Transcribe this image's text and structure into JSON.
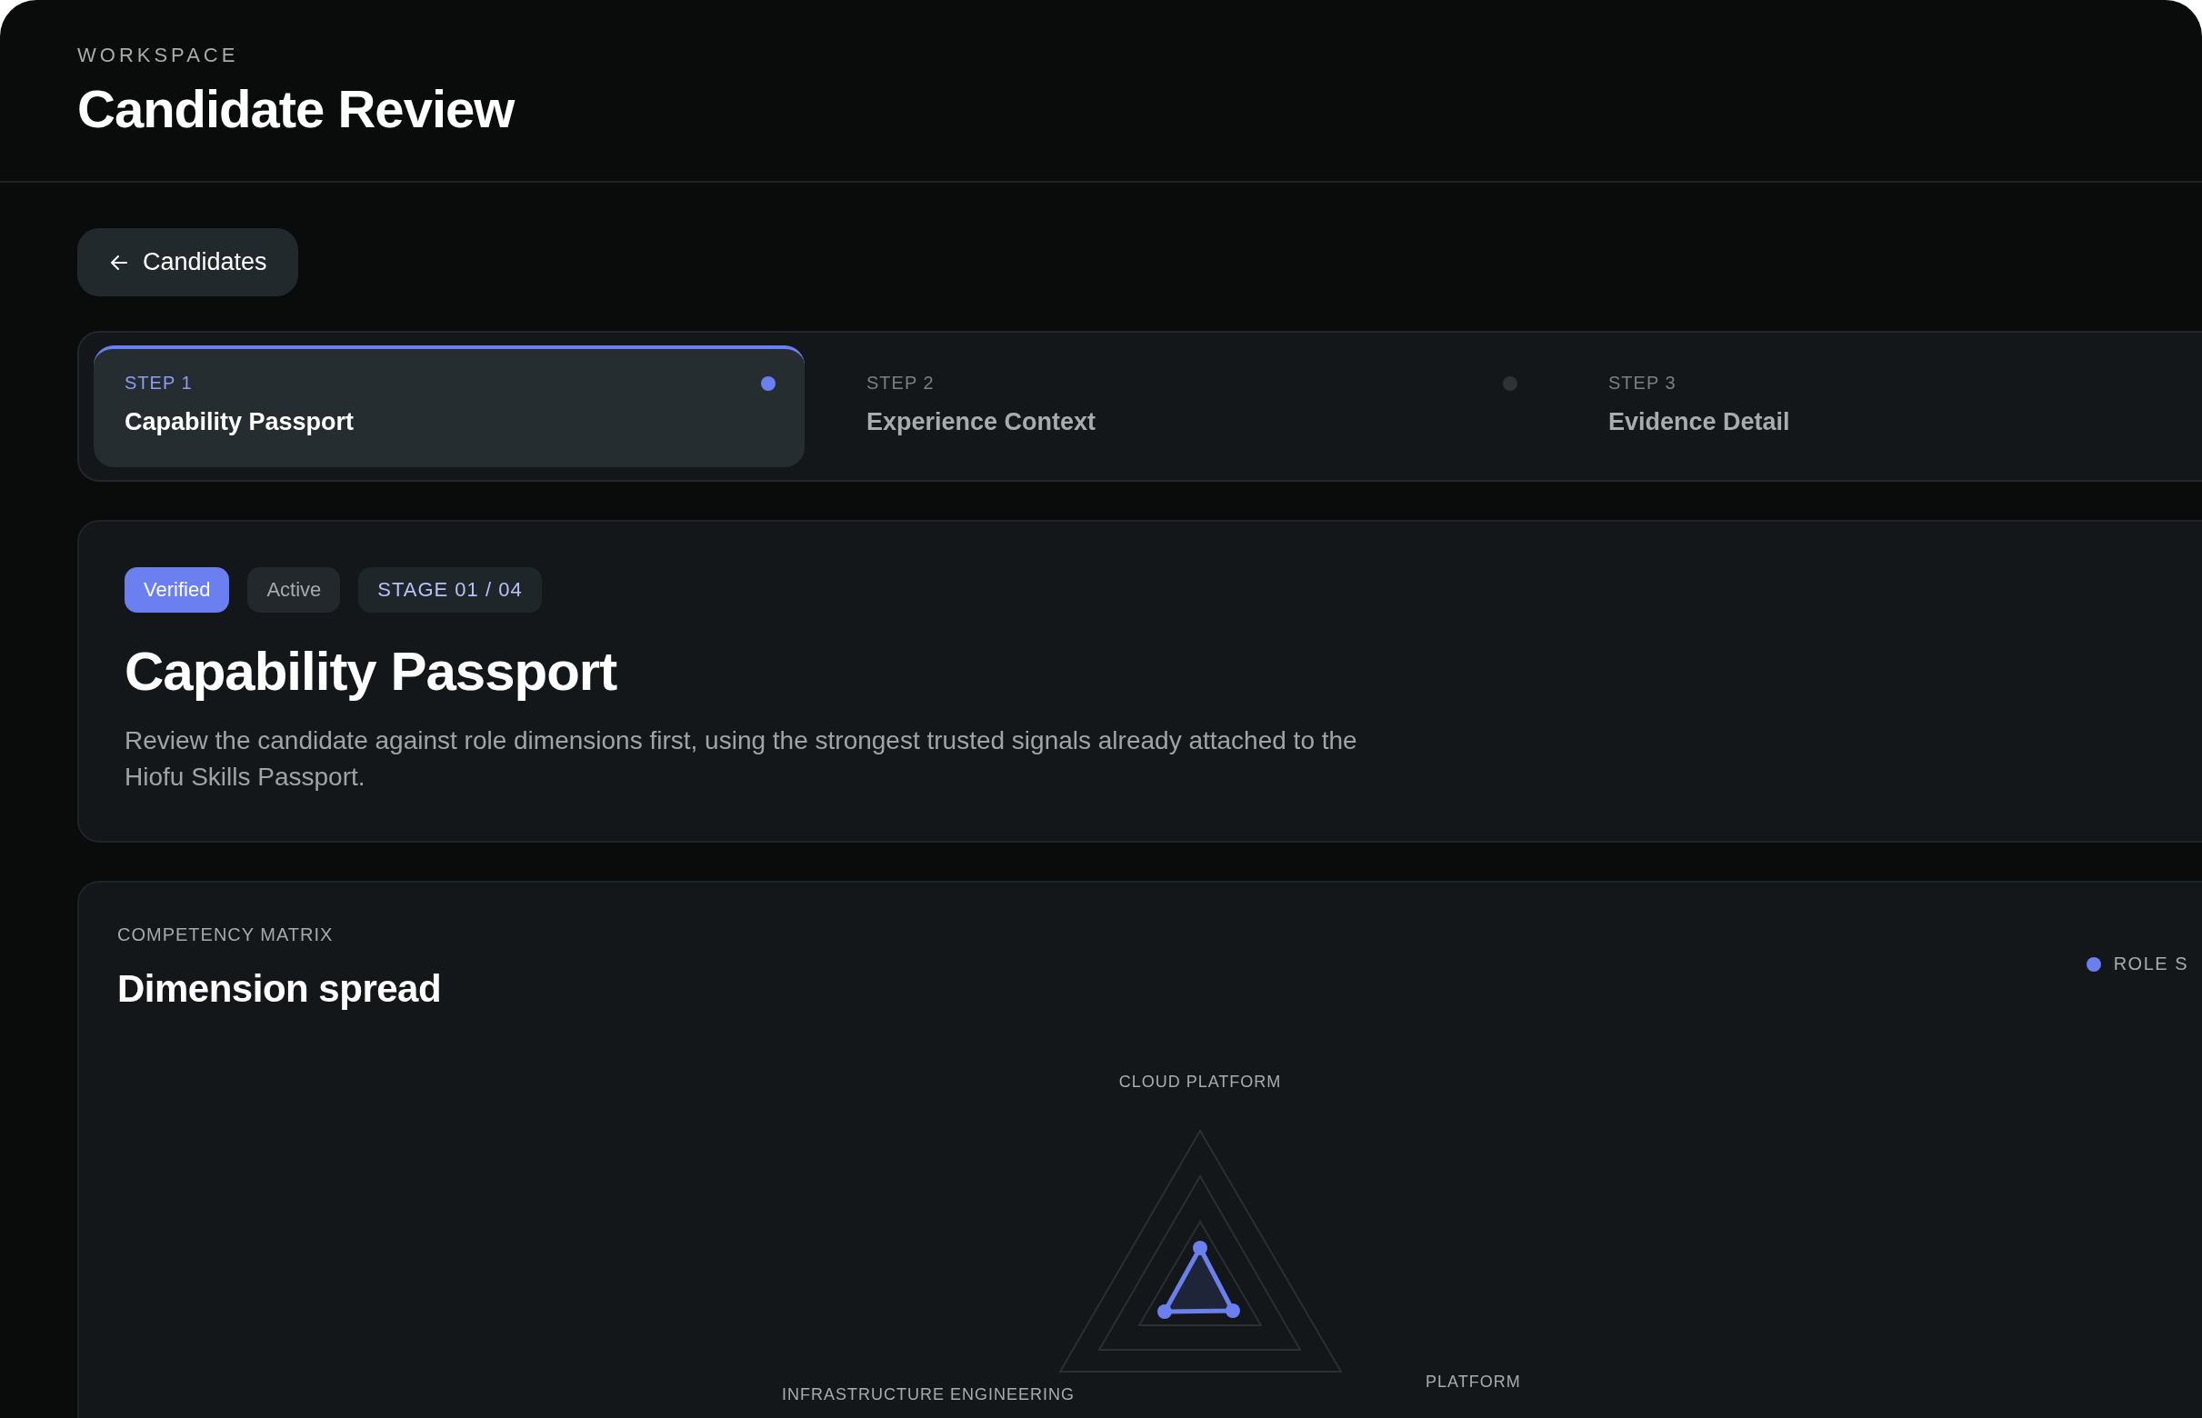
{
  "header": {
    "eyebrow": "WORKSPACE",
    "title": "Candidate Review"
  },
  "back_button": {
    "label": "Candidates"
  },
  "steps": [
    {
      "step": "STEP 1",
      "title": "Capability Passport",
      "selected": true
    },
    {
      "step": "STEP 2",
      "title": "Experience Context",
      "selected": false
    },
    {
      "step": "STEP 3",
      "title": "Evidence Detail",
      "selected": false
    }
  ],
  "intro": {
    "badges": [
      {
        "label": "Verified",
        "kind": "primary"
      },
      {
        "label": "Active",
        "kind": "neutral"
      },
      {
        "label": "STAGE 01 / 04",
        "kind": "stage"
      }
    ],
    "title": "Capability Passport",
    "description": "Review the candidate against role dimensions first, using the strongest trusted signals already attached to the Hiofu Skills Passport."
  },
  "matrix": {
    "eyebrow": "COMPETENCY MATRIX",
    "title": "Dimension spread",
    "legend": [
      {
        "label": "ROLE S",
        "color": "#6b7ff0"
      }
    ],
    "axes": [
      {
        "label": "CLOUD PLATFORM"
      },
      {
        "label": "PLATFORM"
      },
      {
        "label": "INFRASTRUCTURE ENGINEERING"
      }
    ]
  }
}
